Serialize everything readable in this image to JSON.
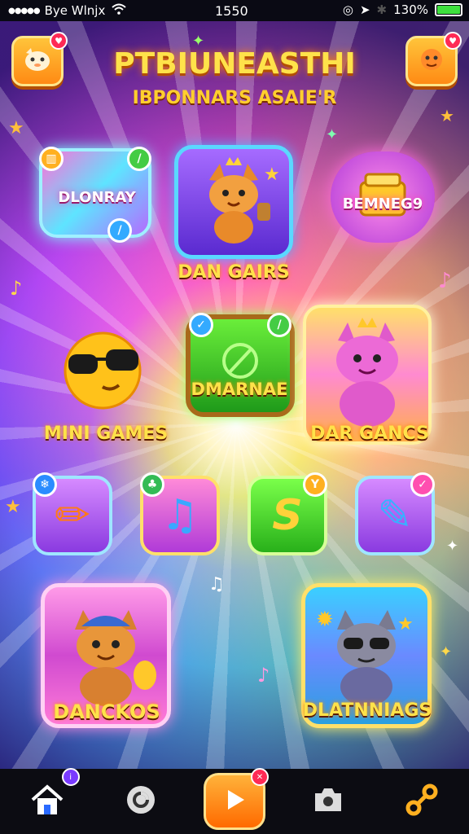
{
  "status_bar": {
    "carrier": "Bye Wlnjx",
    "time": "1550",
    "battery_percent": "130%",
    "battery_level": 1.0
  },
  "header": {
    "title": "PTBIUNEASTHI",
    "subtitle": "IBPONNARS ASAIE'R",
    "left_button_icon": "pet-face-icon",
    "right_button_icon": "orange-creature-icon"
  },
  "tiles": [
    {
      "label": "DLONRAY",
      "icon": "rainbow-stack-icon"
    },
    {
      "label": "DAN GAIRS",
      "icon": "dancing-fox-icon"
    },
    {
      "label": "BEMNEG9",
      "icon": "golden-box-icon"
    },
    {
      "label": "MINI GAMES",
      "icon": "sunglasses-emoji-icon"
    },
    {
      "label": "DMARNAE",
      "icon": "green-board-icon"
    },
    {
      "label": "DAR GANCS",
      "icon": "pink-cat-icon"
    },
    {
      "label": "DANCKOS",
      "icon": "fox-with-cap-icon"
    },
    {
      "label": "DLATNNIAGS",
      "icon": "gray-cat-icon"
    }
  ],
  "small_tiles": [
    {
      "icon": "crayon-orange-icon",
      "glyph": "✏"
    },
    {
      "icon": "music-note-icon",
      "glyph": "♫"
    },
    {
      "icon": "green-s-icon",
      "glyph": "S"
    },
    {
      "icon": "crayon-blue-icon",
      "glyph": "✎"
    }
  ],
  "bottom_nav": [
    {
      "icon": "home-icon",
      "glyph": "⌂"
    },
    {
      "icon": "chat-icon",
      "glyph": "◎"
    },
    {
      "icon": "play-icon",
      "glyph": "▶"
    },
    {
      "icon": "camera-icon",
      "glyph": "▣"
    },
    {
      "icon": "link-icon",
      "glyph": "∂"
    }
  ],
  "colors": {
    "accent_orange": "#ff8a14",
    "title_yellow": "#ffe24a",
    "badge_red": "#ff2a55"
  }
}
